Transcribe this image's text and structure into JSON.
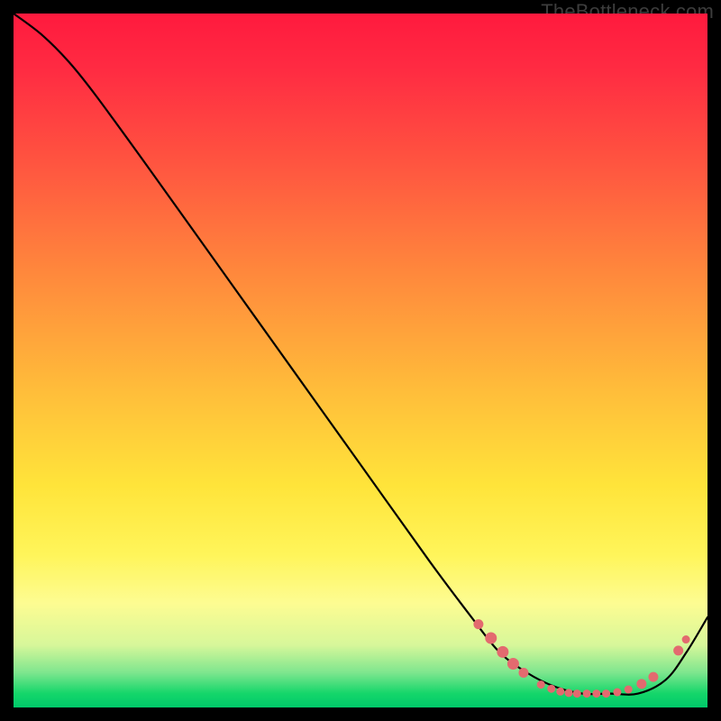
{
  "attribution": "TheBottleneck.com",
  "chart_data": {
    "type": "line",
    "title": "",
    "xlabel": "",
    "ylabel": "",
    "xlim": [
      0,
      100
    ],
    "ylim": [
      0,
      100
    ],
    "series": [
      {
        "name": "curve",
        "x": [
          0,
          4,
          8,
          12,
          20,
          30,
          40,
          50,
          60,
          66,
          70,
          74,
          78,
          82,
          86,
          90,
          94,
          97,
          100
        ],
        "y": [
          100,
          97,
          93,
          88,
          77,
          63,
          49,
          35,
          21,
          13,
          8,
          5,
          3,
          2,
          2,
          2,
          4,
          8,
          13
        ]
      }
    ],
    "markers": {
      "name": "highlight-points",
      "color": "#e36a6f",
      "points": [
        {
          "x": 67.0,
          "y": 12.0,
          "r": 5
        },
        {
          "x": 68.8,
          "y": 10.0,
          "r": 6
        },
        {
          "x": 70.5,
          "y": 8.0,
          "r": 6
        },
        {
          "x": 72.0,
          "y": 6.3,
          "r": 6
        },
        {
          "x": 73.5,
          "y": 5.0,
          "r": 5
        },
        {
          "x": 76.0,
          "y": 3.3,
          "r": 4
        },
        {
          "x": 77.5,
          "y": 2.7,
          "r": 4
        },
        {
          "x": 78.8,
          "y": 2.3,
          "r": 4
        },
        {
          "x": 80.0,
          "y": 2.1,
          "r": 4
        },
        {
          "x": 81.2,
          "y": 2.0,
          "r": 4
        },
        {
          "x": 82.6,
          "y": 2.0,
          "r": 4
        },
        {
          "x": 84.0,
          "y": 2.0,
          "r": 4
        },
        {
          "x": 85.4,
          "y": 2.0,
          "r": 4
        },
        {
          "x": 87.0,
          "y": 2.2,
          "r": 4
        },
        {
          "x": 88.6,
          "y": 2.6,
          "r": 4
        },
        {
          "x": 90.5,
          "y": 3.4,
          "r": 5
        },
        {
          "x": 92.2,
          "y": 4.4,
          "r": 5
        },
        {
          "x": 95.8,
          "y": 8.2,
          "r": 5
        },
        {
          "x": 96.9,
          "y": 9.8,
          "r": 4
        }
      ]
    }
  }
}
